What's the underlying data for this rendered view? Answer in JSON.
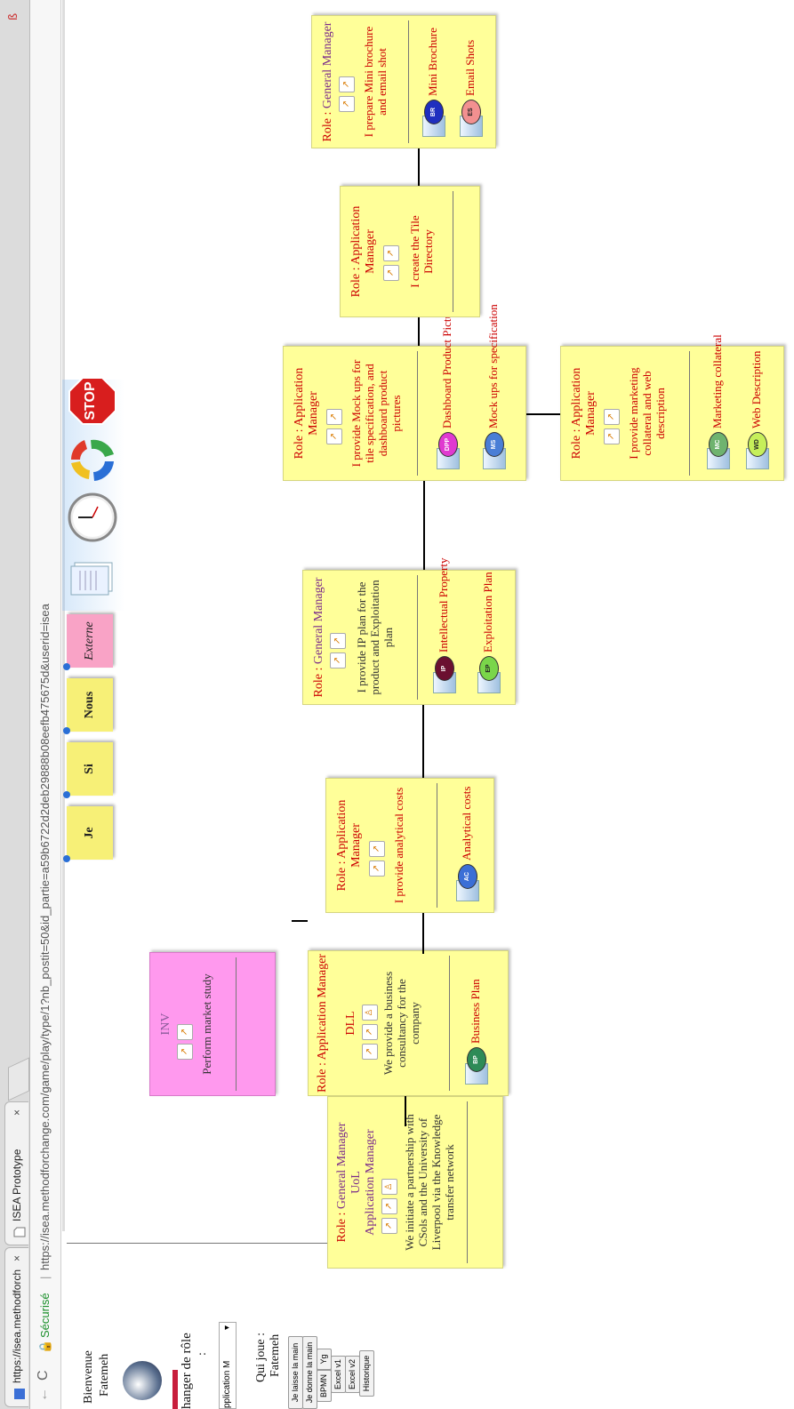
{
  "browser": {
    "tabs": [
      {
        "label": "https://isea.methodforch",
        "close": "×"
      },
      {
        "label": "ISEA Prototype",
        "close": "×"
      }
    ],
    "address": {
      "secure_label": "Sécurisé",
      "url": "https://isea.methodforchange.com/game/play/type/1?nb_postit=50&id_partie=a59b6722d2deb29888b08eefb475675d&userid=isea"
    },
    "nav": {
      "back": "←",
      "reload": "C",
      "ext_icon": "ß"
    }
  },
  "left_panel": {
    "welcome": "Bienvenue",
    "user": "Fatemeh",
    "changer_role": "hanger de rôle",
    "colon": ":",
    "role_select": "pplication M",
    "qui_joue": "Qui joue :",
    "qui_joue_user": "Fatemeh",
    "buttons": [
      "Je laisse la main",
      "Je donne la main",
      "BPMN",
      "Yg",
      "Excel v1",
      "Excel v2",
      "Historique"
    ]
  },
  "postits": [
    {
      "label": "Je",
      "color": "#f7f077"
    },
    {
      "label": "Si",
      "color": "#f7f077"
    },
    {
      "label": "Nous",
      "color": "#f7f077"
    },
    {
      "label": "Externe",
      "color": "#f9a3c6"
    }
  ],
  "toolbar_icons": [
    "notes-icon",
    "clock-icon",
    "refresh-cycle-icon",
    "stop-sign-icon"
  ],
  "stop_label": "STOP",
  "role_prefix": "Role : ",
  "cards": [
    {
      "roles": [
        "General Manager",
        "UoL",
        "Application Manager"
      ],
      "activity": "We initiate a partnership with CSols and the University of Liverpool via the Knowledge transfer network",
      "activity_dark": true,
      "deliverables": []
    },
    {
      "roles": [
        "Application Manager",
        "DLL"
      ],
      "activity": "We provide a business consultancy for the company",
      "activity_dark": true,
      "deliverables": [
        {
          "abbr": "BP",
          "label": "Business Plan",
          "color": "#2e8b57"
        }
      ]
    },
    {
      "team": "INV",
      "activity": "Perform market study",
      "activity_dark": true,
      "deliverables": []
    },
    {
      "roles": [
        "Application Manager"
      ],
      "activity": "I provide analytical costs",
      "deliverables": [
        {
          "abbr": "AC",
          "label": "Analytical costs",
          "color": "#3b6fd6"
        }
      ]
    },
    {
      "roles": [
        "General Manager"
      ],
      "activity": "I provide IP plan for the product and Exploitation plan",
      "activity_dark": true,
      "deliverables": [
        {
          "abbr": "IP",
          "label": "Intellectual Property",
          "color": "#6b1030"
        },
        {
          "abbr": "EP",
          "label": "Exploitation Plan",
          "color": "#7ad64a"
        }
      ]
    },
    {
      "roles": [
        "Application Manager"
      ],
      "activity": "I provide Mock ups for tile specification, and dashboard product pictures",
      "deliverables": [
        {
          "abbr": "DPP",
          "label": "Dashboard Product Picture",
          "color": "#e03ad0"
        },
        {
          "abbr": "MS",
          "label": "Mock ups for specification",
          "color": "#4a7ed6"
        }
      ]
    },
    {
      "roles": [
        "Application Manager"
      ],
      "activity": "I provide marketing collateral and web description",
      "deliverables": [
        {
          "abbr": "MC",
          "label": "Marketing collateral",
          "color": "#6fb36f"
        },
        {
          "abbr": "WD",
          "label": "Web Description",
          "color": "#c6ef5a"
        }
      ]
    },
    {
      "roles": [
        "Application Manager"
      ],
      "activity": "I create the Tile Directory",
      "deliverables": []
    },
    {
      "roles": [
        "General Manager"
      ],
      "activity": "I prepare Mini brochure and email shot",
      "deliverables": [
        {
          "abbr": "BR",
          "label": "Mini Brochure",
          "color": "#1f2fbf"
        },
        {
          "abbr": "ES",
          "label": "Email Shots",
          "color": "#f29090"
        }
      ]
    }
  ]
}
